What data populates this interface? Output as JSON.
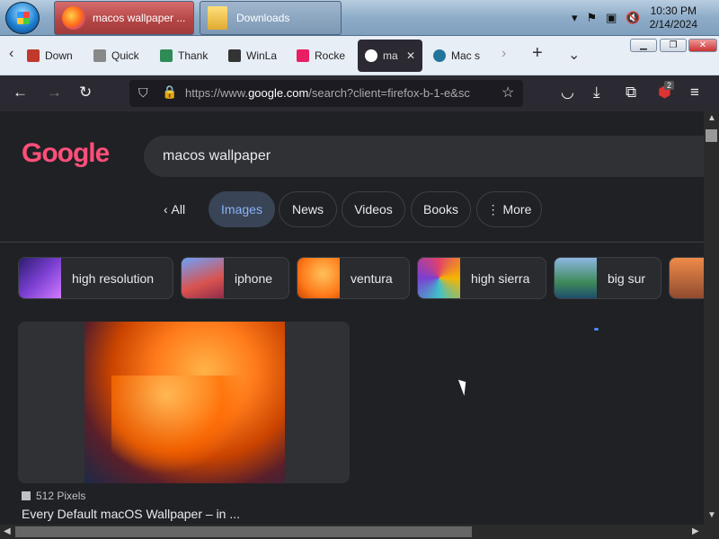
{
  "taskbar": {
    "tasks": [
      {
        "label": "macos wallpaper ..."
      },
      {
        "label": "Downloads"
      }
    ],
    "clock": {
      "time": "10:30 PM",
      "date": "2/14/2024"
    }
  },
  "browser": {
    "tabs": [
      {
        "label": "Down",
        "favicon_color": "#c0392b"
      },
      {
        "label": "Quick",
        "favicon_color": "#888888"
      },
      {
        "label": "Thank",
        "favicon_color": "#2e8b57"
      },
      {
        "label": "WinLa",
        "favicon_color": "#333333"
      },
      {
        "label": "Rocke",
        "favicon_color": "#e91e63"
      },
      {
        "label": "ma",
        "favicon_color": "#4285f4",
        "active": true
      },
      {
        "label": "Mac s",
        "favicon_color": "#21759b"
      }
    ],
    "url": {
      "prefix": "https://www.",
      "domain": "google.com",
      "rest": "/search?client=firefox-b-1-e&sc"
    },
    "badge_count": "2"
  },
  "google": {
    "logo": "Google",
    "query": "macos wallpaper",
    "filters": [
      "All",
      "Images",
      "News",
      "Videos",
      "Books",
      "More"
    ],
    "suggestions": [
      {
        "label": "high resolution",
        "color": "#7b3fd1"
      },
      {
        "label": "iphone",
        "color": "#d9534f"
      },
      {
        "label": "ventura",
        "color": "#ff7a1a"
      },
      {
        "label": "high sierra",
        "color": "#e0426b"
      },
      {
        "label": "big sur",
        "color": "#3f8a5a"
      }
    ],
    "result": {
      "size": "512 Pixels",
      "title": "Every Default macOS Wallpaper – in ..."
    }
  }
}
